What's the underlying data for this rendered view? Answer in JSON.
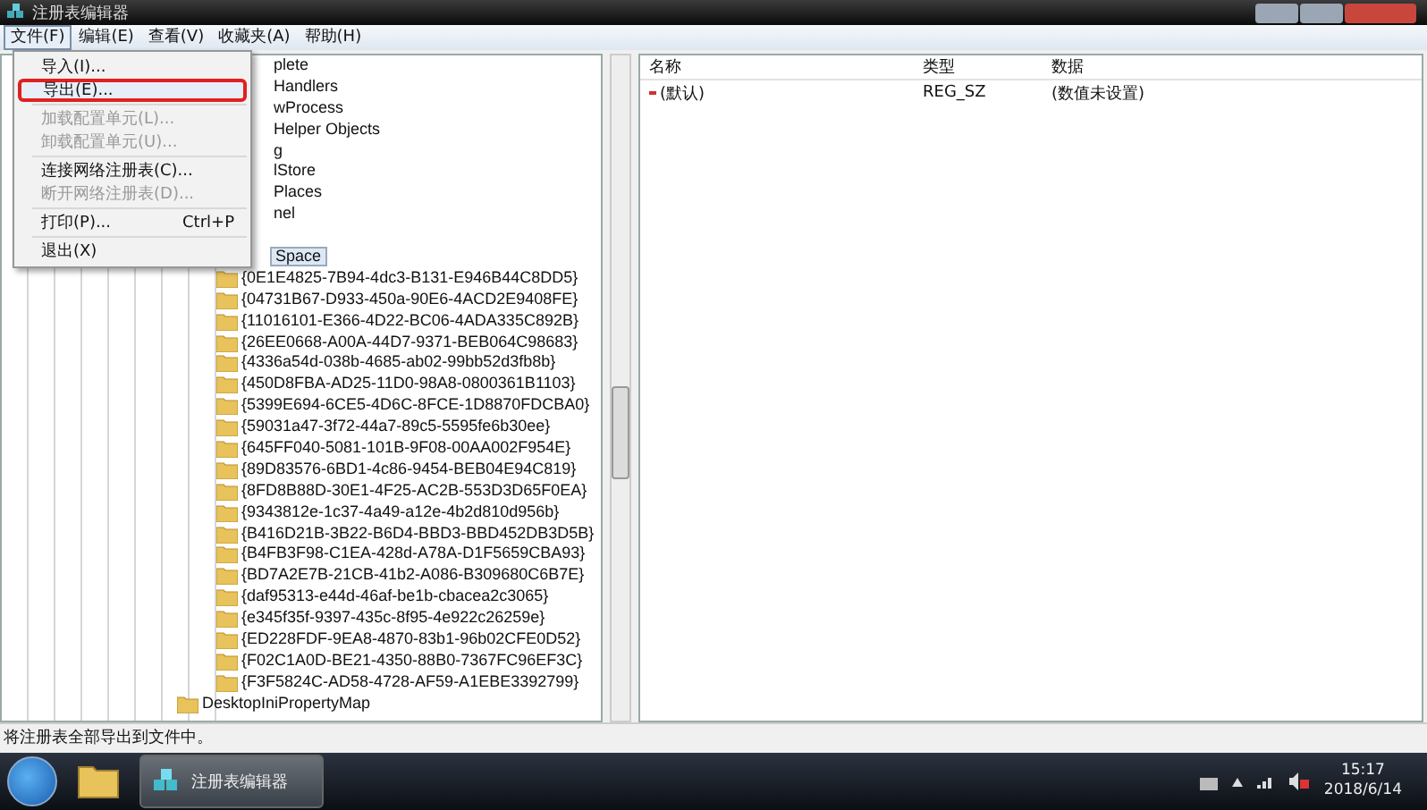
{
  "window": {
    "title": "注册表编辑器"
  },
  "menu_bar": [
    {
      "label": "文件(F)",
      "selected": true
    },
    {
      "label": "编辑(E)",
      "selected": false
    },
    {
      "label": "查看(V)",
      "selected": false
    },
    {
      "label": "收藏夹(A)",
      "selected": false
    },
    {
      "label": "帮助(H)",
      "selected": false
    }
  ],
  "file_menu": [
    {
      "kind": "item",
      "label": "导入(I)...",
      "disabled": false,
      "selected": false
    },
    {
      "kind": "item",
      "label": "导出(E)...",
      "disabled": false,
      "selected": true
    },
    {
      "kind": "separator"
    },
    {
      "kind": "item",
      "label": "加载配置单元(L)...",
      "disabled": true,
      "selected": false
    },
    {
      "kind": "item",
      "label": "卸载配置单元(U)...",
      "disabled": true,
      "selected": false
    },
    {
      "kind": "separator"
    },
    {
      "kind": "item",
      "label": "连接网络注册表(C)...",
      "disabled": false,
      "selected": false
    },
    {
      "kind": "item",
      "label": "断开网络注册表(D)...",
      "disabled": true,
      "selected": false
    },
    {
      "kind": "separator"
    },
    {
      "kind": "item",
      "label": "打印(P)...",
      "shortcut": "Ctrl+P",
      "disabled": false,
      "selected": false
    },
    {
      "kind": "separator"
    },
    {
      "kind": "item",
      "label": "退出(X)",
      "disabled": false,
      "selected": false
    }
  ],
  "tree": {
    "partly_covered": [
      "plete",
      "Handlers",
      "wProcess",
      "Helper Objects",
      "g",
      "lStore",
      "Places",
      "nel"
    ],
    "selected_key": {
      "label": "Space",
      "selected": true,
      "children": [
        "{0E1E4825-7B94-4dc3-B131-E946B44C8DD5}",
        "{04731B67-D933-450a-90E6-4ACD2E9408FE}",
        "{11016101-E366-4D22-BC06-4ADA335C892B}",
        "{26EE0668-A00A-44D7-9371-BEB064C98683}",
        "{4336a54d-038b-4685-ab02-99bb52d3fb8b}",
        "{450D8FBA-AD25-11D0-98A8-0800361B1103}",
        "{5399E694-6CE5-4D6C-8FCE-1D8870FDCBA0}",
        "{59031a47-3f72-44a7-89c5-5595fe6b30ee}",
        "{645FF040-5081-101B-9F08-00AA002F954E}",
        "{89D83576-6BD1-4c86-9454-BEB04E94C819}",
        "{8FD8B88D-30E1-4F25-AC2B-553D3D65F0EA}",
        "{9343812e-1c37-4a49-a12e-4b2d810d956b}",
        "{B416D21B-3B22-B6D4-BBD3-BBD452DB3D5B}",
        "{B4FB3F98-C1EA-428d-A78A-D1F5659CBA93}",
        "{BD7A2E7B-21CB-41b2-A086-B309680C6B7E}",
        "{daf95313-e44d-46af-be1b-cbacea2c3065}",
        "{e345f35f-9397-435c-8f95-4e922c26259e}",
        "{ED228FDF-9EA8-4870-83b1-96b02CFE0D52}",
        "{F02C1A0D-BE21-4350-88B0-7367FC96EF3C}",
        "{F3F5824C-AD58-4728-AF59-A1EBE3392799}"
      ]
    },
    "next_key": "DesktopIniPropertyMap"
  },
  "values": {
    "columns": [
      "名称",
      "类型",
      "数据"
    ],
    "rows": [
      {
        "name": "(默认)",
        "type": "REG_SZ",
        "data": "(数值未设置)"
      }
    ]
  },
  "status_bar": "将注册表全部导出到文件中。",
  "taskbar": {
    "app_button": {
      "label": "注册表编辑器",
      "selected": true
    },
    "time": "15:17",
    "date": "2018/6/14"
  }
}
